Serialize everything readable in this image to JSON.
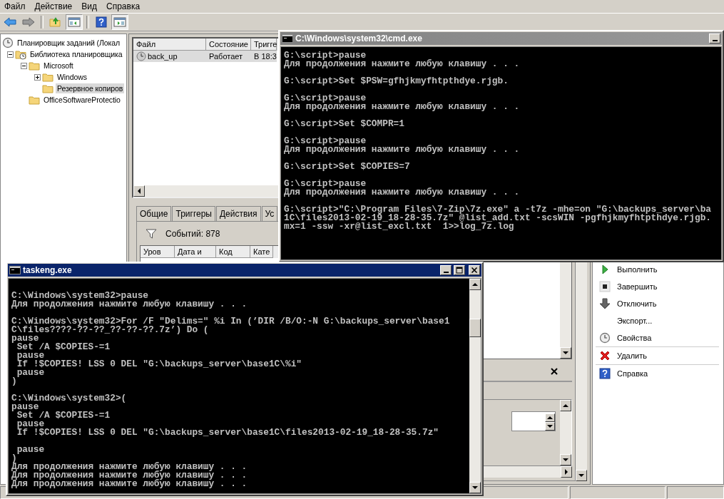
{
  "main_window": {
    "menu": [
      "Файл",
      "Действие",
      "Вид",
      "Справка"
    ],
    "toolbar": [
      {
        "kind": "back",
        "pressed": false
      },
      {
        "kind": "forward",
        "pressed": false
      },
      {
        "kind": "up",
        "pressed": false
      },
      {
        "kind": "tree-pane",
        "pressed": true
      },
      {
        "kind": "help",
        "pressed": false
      },
      {
        "kind": "action-pane",
        "pressed": true
      }
    ],
    "tree": [
      {
        "label": "Планировщик заданий (Локал",
        "kind": "scheduler",
        "selected": false,
        "children": [
          {
            "label": "Библиотека планировщика",
            "kind": "library",
            "selected": false,
            "expanded": true,
            "children": [
              {
                "label": "Microsoft",
                "kind": "folder",
                "selected": false,
                "expanded": true,
                "children": [
                  {
                    "label": "Windows",
                    "kind": "folder",
                    "selected": false,
                    "expanded": false
                  },
                  {
                    "label": "Резервное копиров",
                    "kind": "folder",
                    "selected": true
                  }
                ]
              },
              {
                "label": "OfficeSoftwareProtectio",
                "kind": "folder",
                "selected": false
              }
            ]
          }
        ]
      }
    ],
    "task_list": {
      "columns": [
        "Файл",
        "Состояние",
        "Тригге"
      ],
      "rows": [
        {
          "cells": [
            "back_up",
            "Работает",
            "В 18:3"
          ],
          "selected": true
        }
      ]
    },
    "tabs": [
      {
        "label": "Общие",
        "selected": false
      },
      {
        "label": "Триггеры",
        "selected": false
      },
      {
        "label": "Действия",
        "selected": false
      },
      {
        "label": "Ус",
        "selected": false
      }
    ],
    "events_count": "Событий: 878",
    "events_columns": [
      "Уров",
      "Дата и",
      "Код",
      "Кате"
    ],
    "action_groups": [
      [
        {
          "label": "Выполнить",
          "kind": "run"
        },
        {
          "label": "Завершить",
          "kind": "stop"
        },
        {
          "label": "Отключить",
          "kind": "disable"
        },
        {
          "label": "Экспорт...",
          "kind": "plain"
        },
        {
          "label": "Свойства",
          "kind": "properties"
        }
      ],
      [
        {
          "label": "Удалить",
          "kind": "delete"
        }
      ],
      [
        {
          "label": "Справка",
          "kind": "help"
        }
      ]
    ]
  },
  "consoles": [
    {
      "title": "C:\\Windows\\system32\\cmd.exe",
      "active": false,
      "blocks": [
        [
          "G:\\script>pause",
          "Для продолжения нажмите любую клавишу . . ."
        ],
        [
          "G:\\script>Set $PSW=gfhjkmyfhtpthdye.rjgb."
        ],
        [
          "G:\\script>pause",
          "Для продолжения нажмите любую клавишу . . ."
        ],
        [
          "G:\\script>Set $COMPR=1"
        ],
        [
          "G:\\script>pause",
          "Для продолжения нажмите любую клавишу . . ."
        ],
        [
          "G:\\script>Set $COPIES=7"
        ],
        [
          "G:\\script>pause",
          "Для продолжения нажмите любую клавишу . . ."
        ],
        [
          "G:\\script>\"C:\\Program Files\\7-Zip\\7z.exe\" a -t7z -mhe=on \"G:\\backups_server\\ba",
          "1C\\files2013-02-19_18-28-35.7z\" @list_add.txt -scsWIN -pgfhjkmyfhtpthdye.rjgb.",
          "mx=1 -ssw -xr@list_excl.txt  1>>log_7z.log"
        ]
      ]
    },
    {
      "title": "taskeng.exe",
      "active": true,
      "blocks": [
        [
          "C:\\Windows\\system32>pause",
          "Для продолжения нажмите любую клавишу . . ."
        ],
        [
          "C:\\Windows\\system32>For /F \"Delims=\" %i In (’DIR /B/O:-N G:\\backups_server\\base1",
          "C\\files????-??-??_??-??-??.7z’) Do (",
          "pause",
          " Set /A $COPIES-=1",
          " pause",
          " If !$COPIES! LSS 0 DEL \"G:\\backups_server\\base1C\\%i\"",
          " pause",
          ")"
        ],
        [
          "C:\\Windows\\system32>(",
          "pause",
          " Set /A $COPIES-=1",
          " pause",
          " If !$COPIES! LSS 0 DEL \"G:\\backups_server\\base1C\\files2013-02-19_18-28-35.7z\""
        ],
        [
          " pause",
          ")",
          "Для продолжения нажмите любую клавишу . . .",
          "Для продолжения нажмите любую клавишу . . .",
          "Для продолжения нажмите любую клавишу . . ."
        ]
      ]
    }
  ]
}
